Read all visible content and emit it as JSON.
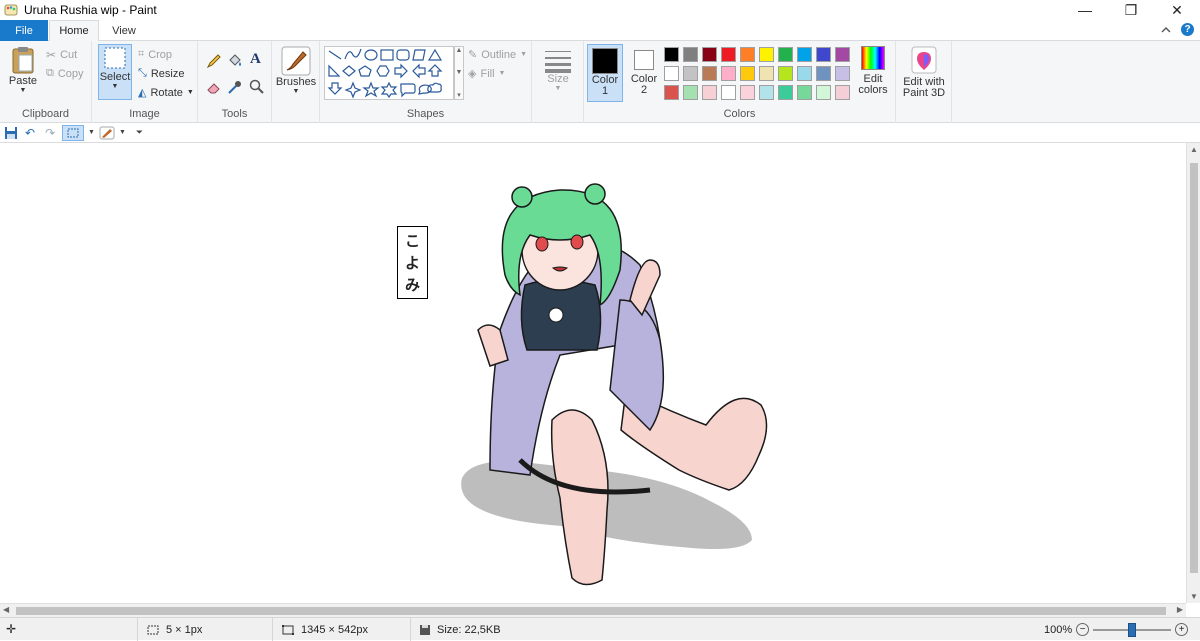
{
  "window": {
    "title": "Uruha Rushia wip - Paint",
    "minimize": "—",
    "restore": "❐",
    "close": "✕"
  },
  "tabs": {
    "file": "File",
    "home": "Home",
    "view": "View"
  },
  "help": "?",
  "ribbon": {
    "clipboard": {
      "label": "Clipboard",
      "paste": "Paste",
      "cut": "Cut",
      "copy": "Copy"
    },
    "image": {
      "label": "Image",
      "select": "Select",
      "crop": "Crop",
      "resize": "Resize",
      "rotate": "Rotate"
    },
    "tools": {
      "label": "Tools"
    },
    "brushes": {
      "label": "Brushes"
    },
    "shapes": {
      "label": "Shapes",
      "outline": "Outline",
      "fill": "Fill"
    },
    "size": {
      "label": "Size"
    },
    "colors": {
      "label": "Colors",
      "color1": "Color\n1",
      "color1_l1": "Color",
      "color1_l2": "1",
      "color2_l1": "Color",
      "color2_l2": "2",
      "edit_colors_l1": "Edit",
      "edit_colors_l2": "colors",
      "palette_row1": [
        "#000000",
        "#7f7f7f",
        "#880015",
        "#ed1c24",
        "#ff7f27",
        "#fff200",
        "#22b14c",
        "#00a2e8",
        "#3f48cc",
        "#a349a4"
      ],
      "palette_row2": [
        "#ffffff",
        "#c3c3c3",
        "#b97a57",
        "#ffaec9",
        "#ffc90e",
        "#efe4b0",
        "#b5e61d",
        "#99d9ea",
        "#7092be",
        "#c8bfe7"
      ],
      "palette_row3": [
        "#d9534f",
        "#a5e0b0",
        "#f7d0d6",
        "#ffffff",
        "#f9d2dc",
        "#b3e3ea",
        "#3ccc9a",
        "#78d89a",
        "#d2f7d8",
        "#f5cfd8"
      ],
      "color1_value": "#000000",
      "color2_value": "#ffffff"
    },
    "paint3d": {
      "l1": "Edit with",
      "l2": "Paint 3D"
    }
  },
  "canvas": {
    "sticker_text": [
      "こ",
      "よ",
      "み"
    ]
  },
  "status": {
    "selection_size": "5 × 1px",
    "image_size": "1345 × 542px",
    "file_size": "Size: 22,5KB",
    "zoom": "100%",
    "zoom_level": 0.5
  }
}
